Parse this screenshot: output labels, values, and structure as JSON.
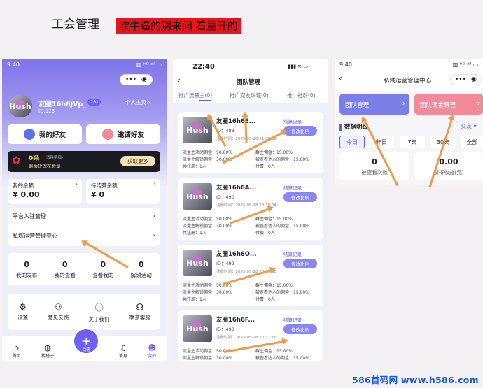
{
  "page_title": "工会管理",
  "banner": "吹牛逼的别来问 看量开的",
  "watermark": "586首码网 www.h586.com",
  "phone1": {
    "status_time": "9:40",
    "status_right": "▥ ᴴᴰ ᵃˡˡ ▭",
    "username": "友圈16h6JVp_",
    "level": "28♯",
    "id_text": "ID:123",
    "homepage_link": "个人主页",
    "avatar_text": "Hush",
    "my_friends": "我的好友",
    "invite_friends": "邀请好友",
    "rose_count": "0朵",
    "rose_sub": "消耗明细›",
    "rose_desc": "剩余玫瑰花数量",
    "get_more": "获取更多",
    "balance_label": "我的余额",
    "balance_value": "¥ 0.00",
    "pending_label": "待结算余额",
    "pending_value": "¥ 0",
    "platform_manage": "平台入驻管理",
    "private_ops": "私域运营管理中心",
    "stats": [
      {
        "value": "0",
        "label": "我的发布"
      },
      {
        "value": "0",
        "label": "我的查看"
      },
      {
        "value": "0",
        "label": "查看我的"
      },
      {
        "value": "0",
        "label": "解锁活动"
      }
    ],
    "tools": [
      {
        "label": "设置"
      },
      {
        "label": "意见反馈"
      },
      {
        "label": "关于我们"
      },
      {
        "label": "联系客服"
      }
    ],
    "nav": [
      {
        "label": "首页"
      },
      {
        "label": "找搭子"
      },
      {
        "label": "动态"
      },
      {
        "label": "消息"
      },
      {
        "label": "我的"
      }
    ]
  },
  "phone2": {
    "status_time": "22:40",
    "status_right": "▮▮▮ ≋ ▭",
    "title": "团队管理",
    "tabs": [
      "推广流量主(0)",
      "推广交友认证(0)",
      "推广社群(0)"
    ],
    "settle_link": "结算记录 ›",
    "modify_btn": "修改比例",
    "avatar_text": "Hush",
    "members": [
      {
        "name": "友圈16h6E...",
        "id": "ID：483",
        "reg": "注册时间：2025-05-28 21:38:39"
      },
      {
        "name": "友圈16h6A...",
        "id": "ID：490",
        "reg": "注册时间：2025-05-28 20:30:04"
      },
      {
        "name": "友圈16h6O...",
        "id": "ID：492",
        "reg": "注册时间：2025-05-28 20:10:08"
      },
      {
        "name": "友圈16h6F...",
        "id": "ID：498",
        "reg": "注册时间：2025-05-28 20:17:16"
      }
    ],
    "stats": [
      [
        "流量主活动佣金：50.00%",
        "群主佣金：15.00%"
      ],
      [
        "流量主解锁佣金：30.00%",
        "被查看达人的佣金：15.00%"
      ],
      [
        "共注册：1人",
        "付费：0人"
      ]
    ]
  },
  "phone3": {
    "status_time": "9:40",
    "status_right": "▥ ᴴᴰ ᵃˡˡ ▭",
    "title": "私域运营管理中心",
    "team_manage": "团队管理",
    "team_commission": "团队佣金管理",
    "data_title": "数据明细",
    "data_filter": "交友",
    "ranges": [
      "今日",
      "昨日",
      "7天",
      "30天",
      "全部"
    ],
    "viewed_value": "0",
    "viewed_label": "被查看次数",
    "earnings_value": "0.00",
    "earnings_label": "获得收益(元)"
  }
}
